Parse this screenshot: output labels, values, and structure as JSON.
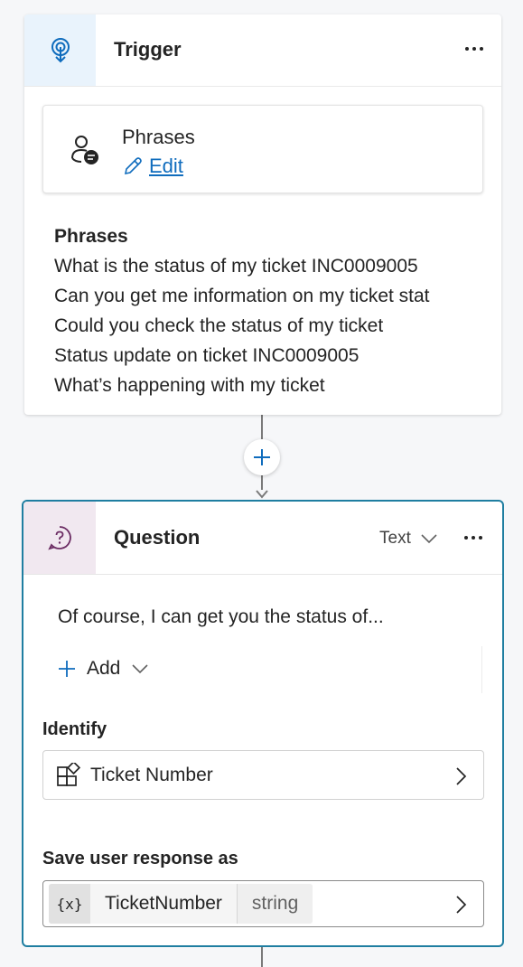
{
  "trigger": {
    "title": "Trigger",
    "icon": "trigger-icon",
    "phrases_box": {
      "title": "Phrases",
      "edit_label": "Edit"
    },
    "phrases_list": {
      "title": "Phrases",
      "items": [
        "What is the status of my ticket INC0009005",
        "Can you get me information on my ticket stat",
        "Could you check the status of my ticket",
        "Status update on ticket INC0009005",
        "What’s happening with my ticket"
      ]
    }
  },
  "connector": {
    "add_node_icon": "plus-icon"
  },
  "question": {
    "title": "Question",
    "icon": "question-icon",
    "response_type": "Text",
    "message": "Of course, I can get you the status of...",
    "add_label": "Add",
    "identify_label": "Identify",
    "identify_value": "Ticket Number",
    "save_label": "Save user response as",
    "variable": {
      "icon_text": "{x}",
      "name": "TicketNumber",
      "type": "string"
    }
  },
  "colors": {
    "accent": "#0f6cbd",
    "selected_border": "#1f7ea1",
    "trigger_icon_bg": "#e9f3fc",
    "question_icon_bg": "#f1e8f0"
  }
}
